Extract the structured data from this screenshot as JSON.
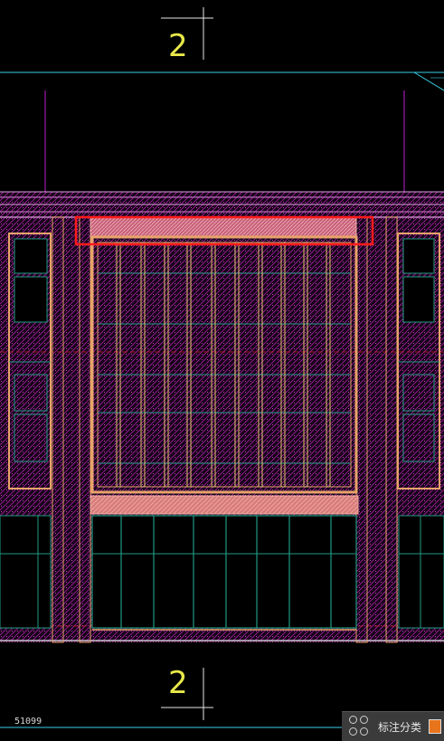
{
  "drawing": {
    "grid_label_top": "2",
    "grid_label_bottom": "2",
    "coordinate_readout": "51099"
  },
  "toolbar": {
    "icon": "grid-circles-icon",
    "label": "标注分类",
    "swatch_color": "#e8741c"
  },
  "colors": {
    "background": "#000000",
    "hatch": "#b01ea6",
    "frame_orange": "#e8a46a",
    "mullion": "#e6c46e",
    "glass_green": "#1f9a82",
    "axis_magenta": "#c020d0",
    "guide_cyan": "#40d0e0",
    "highlight_red": "#ff1a1a",
    "grid_label": "#e8e84a"
  }
}
